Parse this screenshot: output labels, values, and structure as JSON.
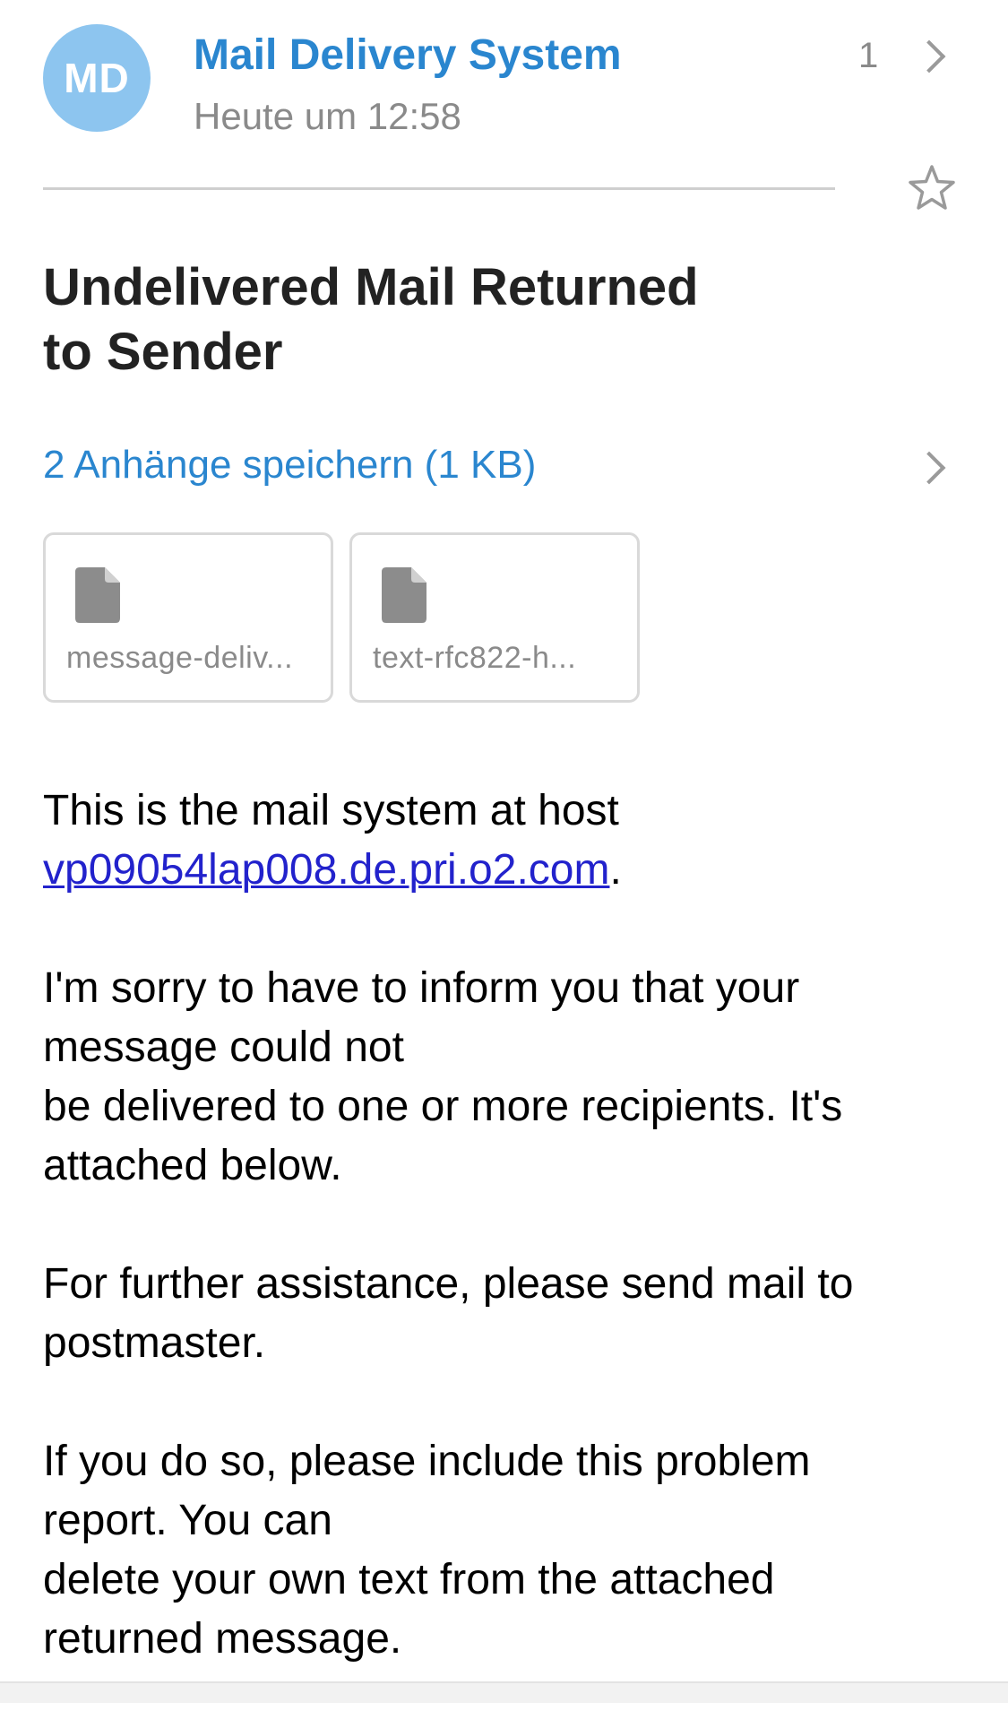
{
  "sender": {
    "initials": "MD",
    "name": "Mail Delivery System",
    "time": "Heute um 12:58",
    "thread_count": "1",
    "avatar_color": "#8dc5ef",
    "accent_color": "#2a86cf"
  },
  "subject": "Undelivered Mail Returned to Sender",
  "attachments": {
    "link_label": "2 Anhänge speichern (1 KB)",
    "items": [
      {
        "name": "message-deliv...",
        "icon": "file-icon"
      },
      {
        "name": "text-rfc822-h...",
        "icon": "file-icon"
      }
    ]
  },
  "body": {
    "p1_text": "This is the mail system at host",
    "p1_link": "vp09054lap008.de.pri.o2.com",
    "p1_after": ".",
    "p2_line1": "I'm sorry to have to inform you that your",
    "p2_line2": "message could not",
    "p2_line3": "be delivered to one or more recipients. It's",
    "p2_line4": "attached below.",
    "p3_line1": "For further assistance, please send mail to",
    "p3_line2": "postmaster.",
    "p4_line1": "If you do so, please include this problem",
    "p4_line2": "report. You can",
    "p4_line3": "delete your own text from the attached",
    "p4_line4": "returned message."
  },
  "icons": {
    "star": "star-icon",
    "chevron": "chevron-right-icon",
    "file": "file-icon"
  }
}
